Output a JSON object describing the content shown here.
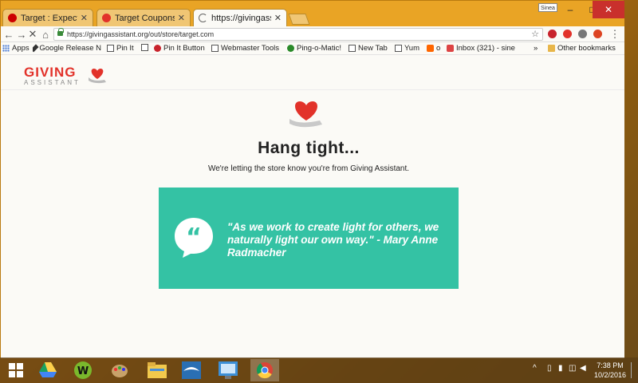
{
  "tabs": [
    {
      "title": "Target : Expect More",
      "active": false
    },
    {
      "title": "Target Coupons: Ob",
      "active": false
    },
    {
      "title": "https://givingassista",
      "active": true
    }
  ],
  "user_chip": "Sinea",
  "window_controls": {
    "minimize": "–",
    "maximize": "□",
    "close": "✕"
  },
  "address_bar": {
    "url": "https://givingassistant.org/out/store/target.com"
  },
  "bookmarks": {
    "apps": "Apps",
    "items": [
      "Google Release N",
      "Pin It",
      "Pin It Button",
      "Webmaster Tools",
      "Ping-o-Matic!",
      "New Tab",
      "Yum",
      "o",
      "Inbox (321) - sine"
    ],
    "more": "»",
    "other": "Other bookmarks"
  },
  "site": {
    "logo_main": "GIVING",
    "logo_sub": "ASSISTANT"
  },
  "main": {
    "title": "Hang tight...",
    "subtitle": "We're letting the store know you're from Giving Assistant.",
    "quote": "\"As we work to create light for others, we naturally light our own way.\" - Mary Anne Radmacher"
  },
  "taskbar": {
    "time": "7:38 PM",
    "date": "10/2/2016"
  },
  "colors": {
    "brand_red": "#e2322a",
    "quote_bg": "#34c2a4",
    "chrome_frame": "#e9a425"
  }
}
